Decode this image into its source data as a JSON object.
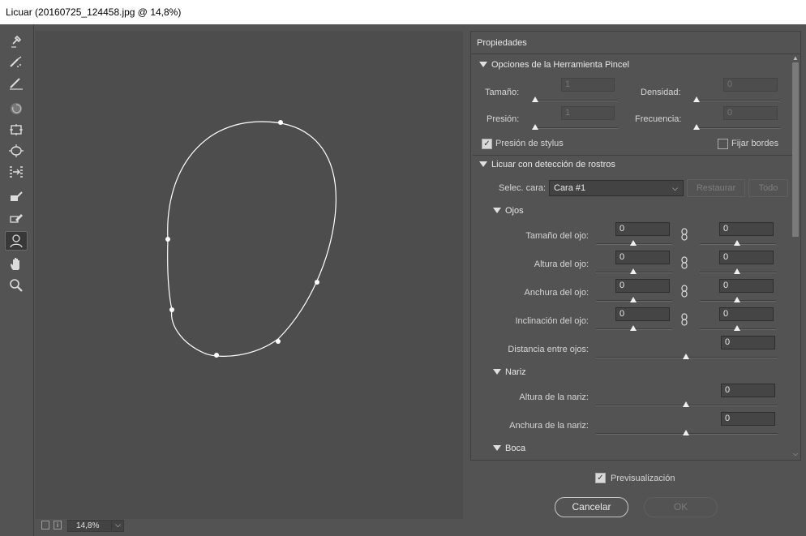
{
  "window": {
    "title": "Licuar (20160725_124458.jpg @ 14,8%)"
  },
  "tools": [
    {
      "name": "forward-warp-tool-icon"
    },
    {
      "name": "reconstruct-tool-icon"
    },
    {
      "name": "smooth-tool-icon"
    },
    {
      "name": "twirl-tool-icon"
    },
    {
      "name": "pucker-tool-icon"
    },
    {
      "name": "bloat-tool-icon"
    },
    {
      "name": "push-left-tool-icon"
    },
    {
      "name": "freeze-mask-tool-icon"
    },
    {
      "name": "thaw-mask-tool-icon"
    },
    {
      "name": "face-tool-icon",
      "active": true
    },
    {
      "name": "hand-tool-icon"
    },
    {
      "name": "zoom-tool-icon"
    }
  ],
  "status": {
    "zoom": "14,8%"
  },
  "panel": {
    "title": "Propiedades",
    "brush": {
      "heading": "Opciones de la Herramienta Pincel",
      "size_label": "Tamaño:",
      "size_value": "1",
      "density_label": "Densidad:",
      "density_value": "0",
      "pressure_label": "Presión:",
      "pressure_value": "1",
      "rate_label": "Frecuencia:",
      "rate_value": "0",
      "stylus_label": "Presión de stylus",
      "stylus_checked": true,
      "pin_edges_label": "Fijar bordes",
      "pin_edges_checked": false
    },
    "face": {
      "heading": "Licuar con detección de rostros",
      "select_label": "Selec. cara:",
      "select_value": "Cara #1",
      "reset_label": "Restaurar",
      "all_label": "Todo",
      "eyes_heading": "Ojos",
      "eye_rows": [
        {
          "label": "Tamaño del ojo:",
          "left": "0",
          "right": "0"
        },
        {
          "label": "Altura del ojo:",
          "left": "0",
          "right": "0"
        },
        {
          "label": "Anchura del ojo:",
          "left": "0",
          "right": "0"
        },
        {
          "label": "Inclinación del ojo:",
          "left": "0",
          "right": "0"
        }
      ],
      "eye_distance_label": "Distancia entre ojos:",
      "eye_distance_value": "0",
      "nose_heading": "Nariz",
      "nose_height_label": "Altura de la nariz:",
      "nose_height_value": "0",
      "nose_width_label": "Anchura de la nariz:",
      "nose_width_value": "0",
      "mouth_heading": "Boca"
    }
  },
  "footer": {
    "preview_label": "Previsualización",
    "preview_checked": true,
    "cancel_label": "Cancelar",
    "ok_label": "OK"
  },
  "colors": {
    "panel_bg": "#535353",
    "canvas_bg": "#4d4d4d",
    "titlebar_bg": "#ffffff"
  }
}
